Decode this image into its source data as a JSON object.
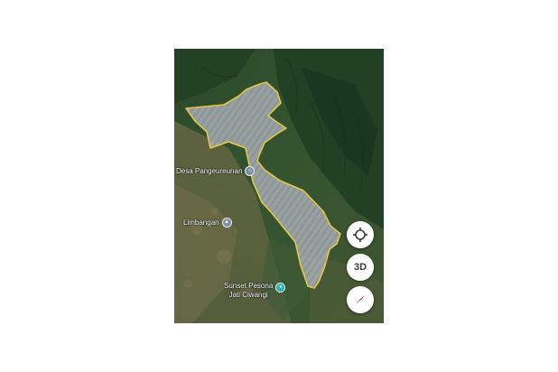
{
  "map": {
    "places": [
      {
        "name": "Desa Pangeureunan",
        "icon": "village-pin-icon"
      },
      {
        "name": "Limbangan",
        "icon": "school-pin-icon"
      },
      {
        "name_line1": "Sunset Pesona",
        "name_line2": "Jati Ciwangi",
        "icon": "camera-pin-icon"
      }
    ],
    "boundary": {
      "color": "#e8c547",
      "fill": "#b8bcc4"
    },
    "controls": {
      "locate_icon": "crosshair-icon",
      "three_d_label": "3D",
      "compass_icon": "compass-icon"
    }
  }
}
